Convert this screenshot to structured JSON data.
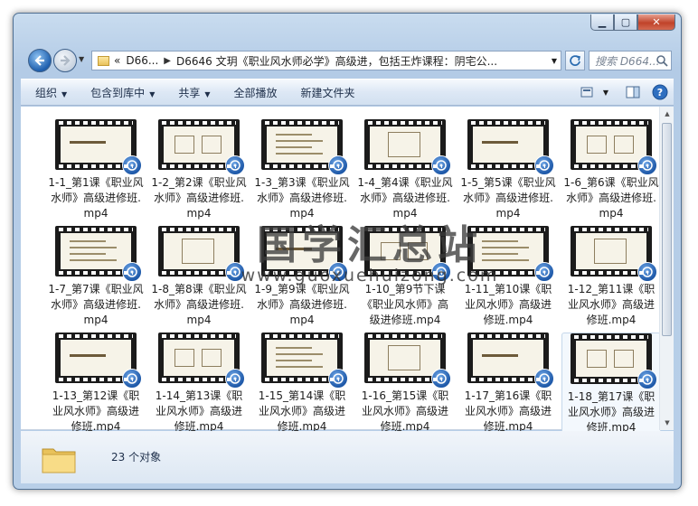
{
  "window": {
    "controls": {
      "minimize": "▁",
      "maximize": "▢",
      "close": "✕"
    }
  },
  "address": {
    "back_icon": "back-arrow-icon",
    "forward_icon": "forward-arrow-icon",
    "crumb_overflow": "«",
    "crumb_parent": "D66...",
    "crumb_current": "D6646 文玥《职业风水师必学》高级进，包括王炸课程：阴宅公...",
    "search_placeholder": "搜索 D664..."
  },
  "toolbar": {
    "organize": "组织",
    "include_in_library": "包含到库中",
    "share": "共享",
    "play_all": "全部播放",
    "new_folder": "新建文件夹"
  },
  "files": [
    {
      "name": "1-1_第1课《职业风水师》高级进修班.mp4"
    },
    {
      "name": "1-2_第2课《职业风水师》高级进修班.mp4"
    },
    {
      "name": "1-3_第3课《职业风水师》高级进修班.mp4"
    },
    {
      "name": "1-4_第4课《职业风水师》高级进修班.mp4"
    },
    {
      "name": "1-5_第5课《职业风水师》高级进修班.mp4"
    },
    {
      "name": "1-6_第6课《职业风水师》高级进修班.mp4"
    },
    {
      "name": "1-7_第7课《职业风水师》高级进修班.mp4"
    },
    {
      "name": "1-8_第8课《职业风水师》高级进修班.mp4"
    },
    {
      "name": "1-9_第9课《职业风水师》高级进修班.mp4"
    },
    {
      "name": "1-10_第9节下课《职业风水师》高级进修班.mp4"
    },
    {
      "name": "1-11_第10课《职业风水师》高级进修班.mp4"
    },
    {
      "name": "1-12_第11课《职业风水师》高级进修班.mp4"
    },
    {
      "name": "1-13_第12课《职业风水师》高级进修班.mp4"
    },
    {
      "name": "1-14_第13课《职业风水师》高级进修班.mp4"
    },
    {
      "name": "1-15_第14课《职业风水师》高级进修班.mp4"
    },
    {
      "name": "1-16_第15课《职业风水师》高级进修班.mp4"
    },
    {
      "name": "1-17_第16课《职业风水师》高级进修班.mp4"
    },
    {
      "name": "1-18_第17课《职业风水师》高级进修班.mp4"
    }
  ],
  "watermark": {
    "title": "国学汇总站",
    "url": "www.guoxuehuizong.com"
  },
  "status": {
    "count_text": "23 个对象"
  }
}
